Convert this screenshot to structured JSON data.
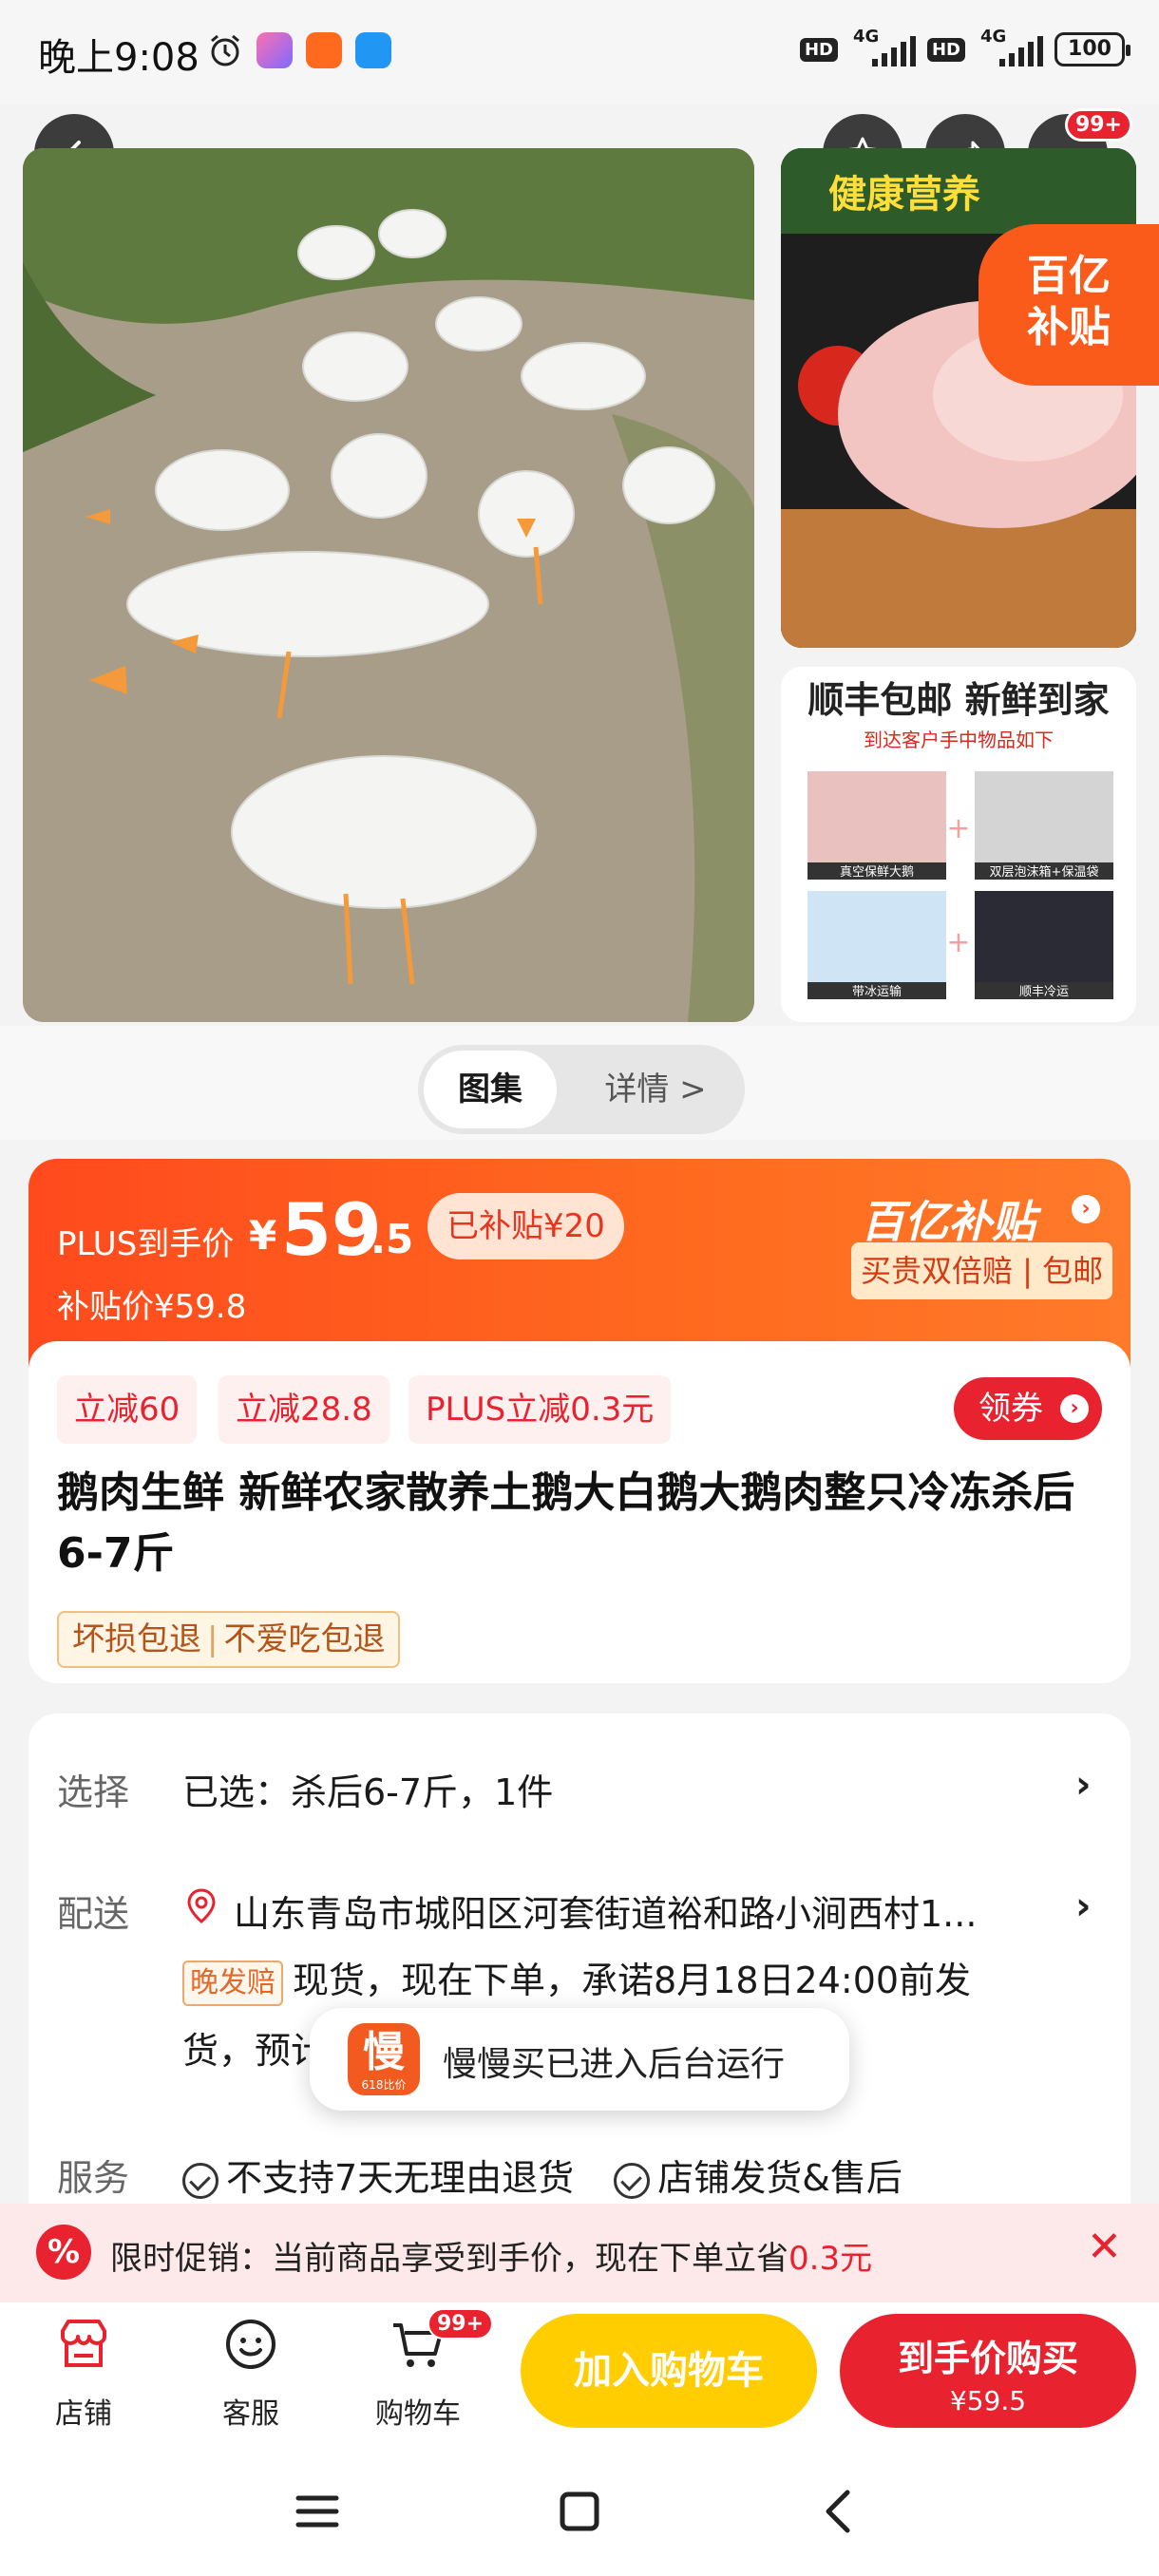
{
  "status_bar": {
    "time": "晚上9:08",
    "hd1": "HD",
    "net1": "4G",
    "hd2": "HD",
    "net2": "4G",
    "battery": "100"
  },
  "top_nav": {
    "more_badge": "99+"
  },
  "gallery": {
    "corner_badge_line1": "百亿",
    "corner_badge_line2": "补贴",
    "side_top_banner": "健康营养",
    "side_bottom_title": "顺丰包邮 新鲜到家",
    "side_bottom_subtitle": "到达客户手中物品如下",
    "items": [
      "真空保鲜大鹅",
      "双层泡沫箱+保温袋",
      "带冰运输",
      "顺丰冷运"
    ]
  },
  "tabs": {
    "gallery": "图集",
    "detail": "详情 >"
  },
  "price": {
    "label": "PLUS到手价",
    "yen": "¥",
    "integer": "59",
    "decimal": ".5",
    "subsidized": "已补贴¥20",
    "subsidy_price": "补贴价¥59.8",
    "brand": "百亿补贴",
    "brand_strap": "买贵双倍赔 | 包邮"
  },
  "promos": [
    "立减60",
    "立减28.8",
    "PLUS立减0.3元"
  ],
  "coupon_label": "领券",
  "product": {
    "title": "鹅肉生鲜 新鲜农家散养土鹅大白鹅大鹅肉整只冷冻杀后6-7斤",
    "guarantee_1": "坏损包退",
    "guarantee_sep": "|",
    "guarantee_2": "不爱吃包退"
  },
  "options": {
    "select_label": "选择",
    "select_value": "已选：杀后6-7斤，1件",
    "delivery_label": "配送",
    "address": "山东青岛市城阳区河套街道裕和路小涧西村1...",
    "late_tag": "晚发赔",
    "delivery_line1": "现货，现在下单，承诺8月18日24:00前发",
    "delivery_line2": "货，预计",
    "service_label": "服务",
    "service_1": "不支持7天无理由退货",
    "service_2": "店铺发货&售后"
  },
  "toast": {
    "logo_char": "慢",
    "logo_sub": "618比价",
    "text": "慢慢买已进入后台运行"
  },
  "promo_bar": {
    "icon": "%",
    "text": "限时促销：当前商品享受到手价，现在下单立省",
    "amount": "0.3元",
    "close": "✕"
  },
  "action_bar": {
    "store": "店铺",
    "service": "客服",
    "cart": "购物车",
    "cart_badge": "99+",
    "add_to_cart": "加入购物车",
    "buy_title": "到手价购买",
    "buy_price": "¥59.5"
  },
  "colors": {
    "brand_red": "#e8222e",
    "subsidy_orange": "#ff4a1d",
    "add_cart_yellow": "#ffcd00"
  }
}
